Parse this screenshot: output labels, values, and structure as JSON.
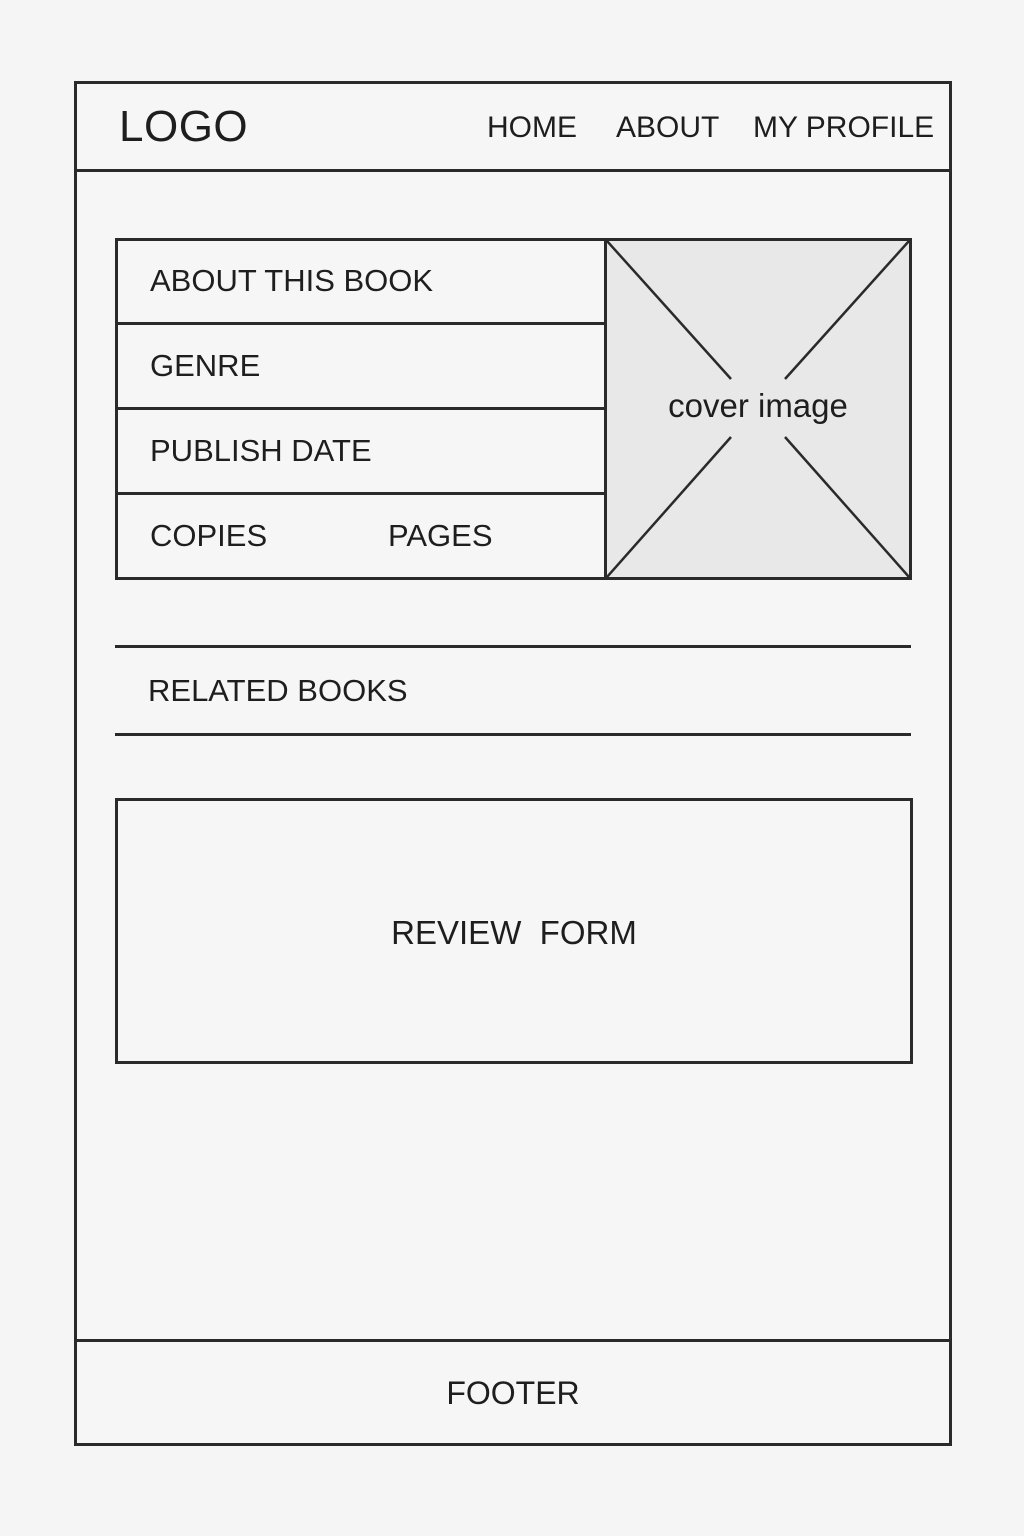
{
  "header": {
    "logo": "LOGO",
    "nav": {
      "home": "HOME",
      "about": "ABOUT",
      "profile": "MY PROFILE"
    }
  },
  "book_info": {
    "about": "ABOUT THIS BOOK",
    "genre": "GENRE",
    "publish_date": "PUBLISH DATE",
    "copies": "COPIES",
    "pages": "PAGES"
  },
  "cover": {
    "label": "cover image"
  },
  "related": {
    "label": "RELATED BOOKS"
  },
  "review": {
    "label": "REVIEW  FORM"
  },
  "footer": {
    "label": "FOOTER"
  }
}
